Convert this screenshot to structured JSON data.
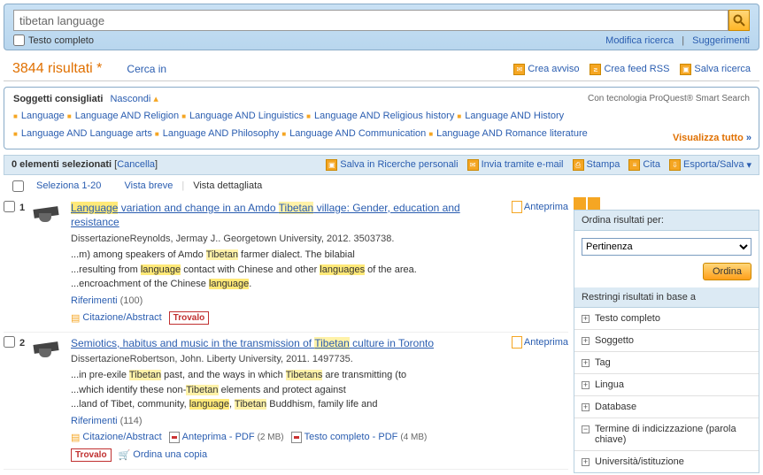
{
  "search": {
    "query": "tibetan language",
    "full_text_label": "Testo completo",
    "modify": "Modifica ricerca",
    "suggestions": "Suggerimenti"
  },
  "header": {
    "count": "3844 risultati",
    "cerca_in": "Cerca in",
    "crea_avviso": "Crea avviso",
    "crea_feed": "Crea feed RSS",
    "salva_ricerca": "Salva ricerca"
  },
  "suggested": {
    "title": "Soggetti consigliati",
    "hide": "Nascondi",
    "tech": "Con tecnologia ProQuest® Smart Search",
    "visualizza": "Visualizza tutto",
    "items": [
      "Language",
      "Language AND Religion",
      "Language AND Linguistics",
      "Language AND Religious history",
      "Language AND History",
      "Language AND Language arts",
      "Language AND Philosophy",
      "Language AND Communication",
      "Language AND Romance literature"
    ]
  },
  "actions": {
    "selected": "0 elementi selezionati",
    "cancel": "Cancella",
    "save_search": "Salva in Ricerche personali",
    "email": "Invia tramite e-mail",
    "print": "Stampa",
    "cite": "Cita",
    "export": "Esporta/Salva"
  },
  "view": {
    "select": "Seleziona 1-20",
    "brief": "Vista breve",
    "detailed": "Vista dettagliata"
  },
  "results": [
    {
      "num": "1",
      "title_pre": "",
      "title_hl1": "Language",
      "title_mid": " variation and change in an Amdo ",
      "title_hl2": "Tibetan",
      "title_post": " village: Gender, education and resistance",
      "meta": "DissertazioneReynolds, Jermay J.. Georgetown University, 2012. 3503738.",
      "snip1a": "...m) among speakers of Amdo ",
      "snip1_hl": "Tibetan",
      "snip1b": " farmer dialect. The bilabial",
      "snip2a": "...resulting from ",
      "snip2_hl1": "language",
      "snip2b": " contact with Chinese and other ",
      "snip2_hl2": "languages",
      "snip2c": " of the area.",
      "snip3a": "...encroachment of the Chinese ",
      "snip3_hl": "language",
      "snip3b": ".",
      "ref": "Riferimenti",
      "ref_count": "(100)",
      "cite_abstract": "Citazione/Abstract",
      "trovalo": "Trovalo",
      "anteprima": "Anteprima"
    },
    {
      "num": "2",
      "title_pre": "Semiotics, habitus and music in the transmission of ",
      "title_hl": "Tibetan",
      "title_post": " culture in Toronto",
      "meta": "DissertazioneRobertson, John. Liberty University, 2011. 1497735.",
      "snip1a": "...in pre-exile ",
      "snip1_hl1": "Tibetan",
      "snip1b": " past, and the ways in which ",
      "snip1_hl2": "Tibetans",
      "snip1c": " are transmitting (to",
      "snip2a": "...which identify these non-",
      "snip2_hl": "Tibetan",
      "snip2b": " elements and protect against",
      "snip3a": "...land of Tibet, community, ",
      "snip3_hl1": "language",
      "snip3b": ", ",
      "snip3_hl2": "Tibetan",
      "snip3c": " Buddhism, family life and",
      "ref": "Riferimenti",
      "ref_count": "(114)",
      "cite_abstract": "Citazione/Abstract",
      "anteprima_pdf": "Anteprima - PDF",
      "anteprima_size": "(2 MB)",
      "full_pdf": "Testo completo - PDF",
      "full_size": "(4 MB)",
      "trovalo": "Trovalo",
      "ordina_copia": "Ordina una copia",
      "anteprima": "Anteprima"
    }
  ],
  "side": {
    "sort_label": "Ordina risultati per:",
    "sort_value": "Pertinenza",
    "sort_btn": "Ordina",
    "narrow_label": "Restringi risultati in base a",
    "facets": [
      {
        "label": "Testo completo",
        "open": false
      },
      {
        "label": "Soggetto",
        "open": false
      },
      {
        "label": "Tag",
        "open": false
      },
      {
        "label": "Lingua",
        "open": false
      },
      {
        "label": "Database",
        "open": false
      },
      {
        "label": "Termine di indicizzazione (parola chiave)",
        "open": true
      },
      {
        "label": "Università/istituzione",
        "open": false
      }
    ]
  }
}
